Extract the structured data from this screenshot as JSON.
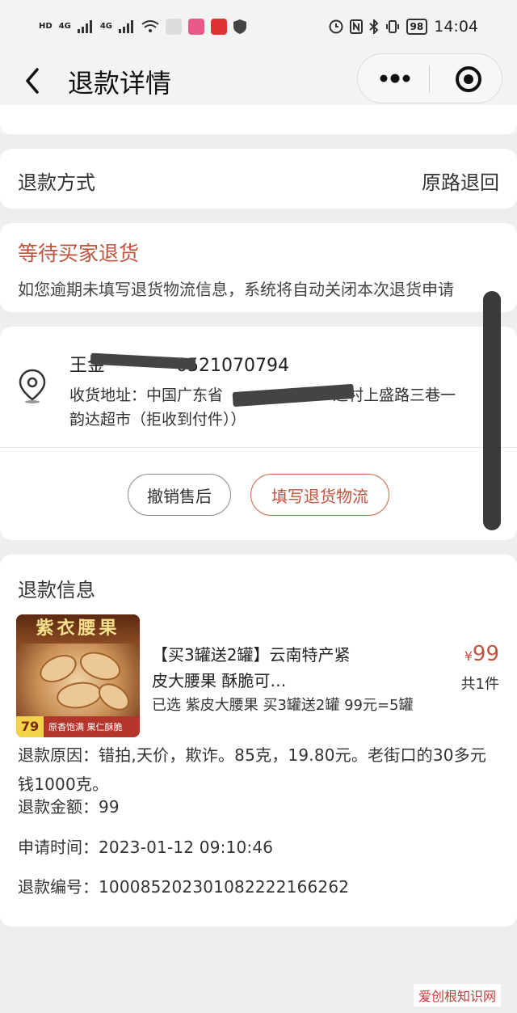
{
  "status_bar": {
    "left_badges": [
      "HD",
      "4G",
      "4G"
    ],
    "battery": "98",
    "time": "14:04"
  },
  "navbar": {
    "title": "退款详情",
    "icons": [
      "back-icon",
      "more-icon",
      "target-icon"
    ]
  },
  "refund_method": {
    "label": "退款方式",
    "value": "原路退回"
  },
  "status": {
    "title": "等待买家退货",
    "description": "如您逾期未填写退货物流信息，系统将自动关闭本次退货申请"
  },
  "address": {
    "name": "王金",
    "phone_tail": "0521070794",
    "line1_prefix": "收货地址：中国广东省",
    "line1_suffix": "近村上盛路三巷一",
    "line2": "韵达超市（拒收到付件））",
    "buttons": {
      "cancel": "撤销售后",
      "fill_logistics": "填写退货物流"
    }
  },
  "refund_info": {
    "section_title": "退款信息",
    "product": {
      "image_banner": "紫衣腰果",
      "image_price": "79",
      "image_tag": "原香饱满 果仁酥脆",
      "title": "【买3罐送2罐】云南特产紧皮大腰果 酥脆可…",
      "spec": "已选 紫皮大腰果 买3罐送2罐 99元=5罐",
      "price_symbol": "¥",
      "price": "99",
      "quantity": "共1件"
    },
    "reason_label": "退款原因：",
    "reason_value": "错拍,天价，欺诈。85克，19.80元。老街口的30多元钱1000克。",
    "amount_label": "退款金额：",
    "amount_value": "99",
    "time_label": "申请时间：",
    "time_value": "2023-01-12 09:10:46",
    "refno_label": "退款编号：",
    "refno_value": "100085202301082222166262"
  },
  "watermark": "爱创根知识网",
  "colors": {
    "accent": "#c0533d",
    "background": "#eeeeee",
    "card": "#ffffff"
  }
}
